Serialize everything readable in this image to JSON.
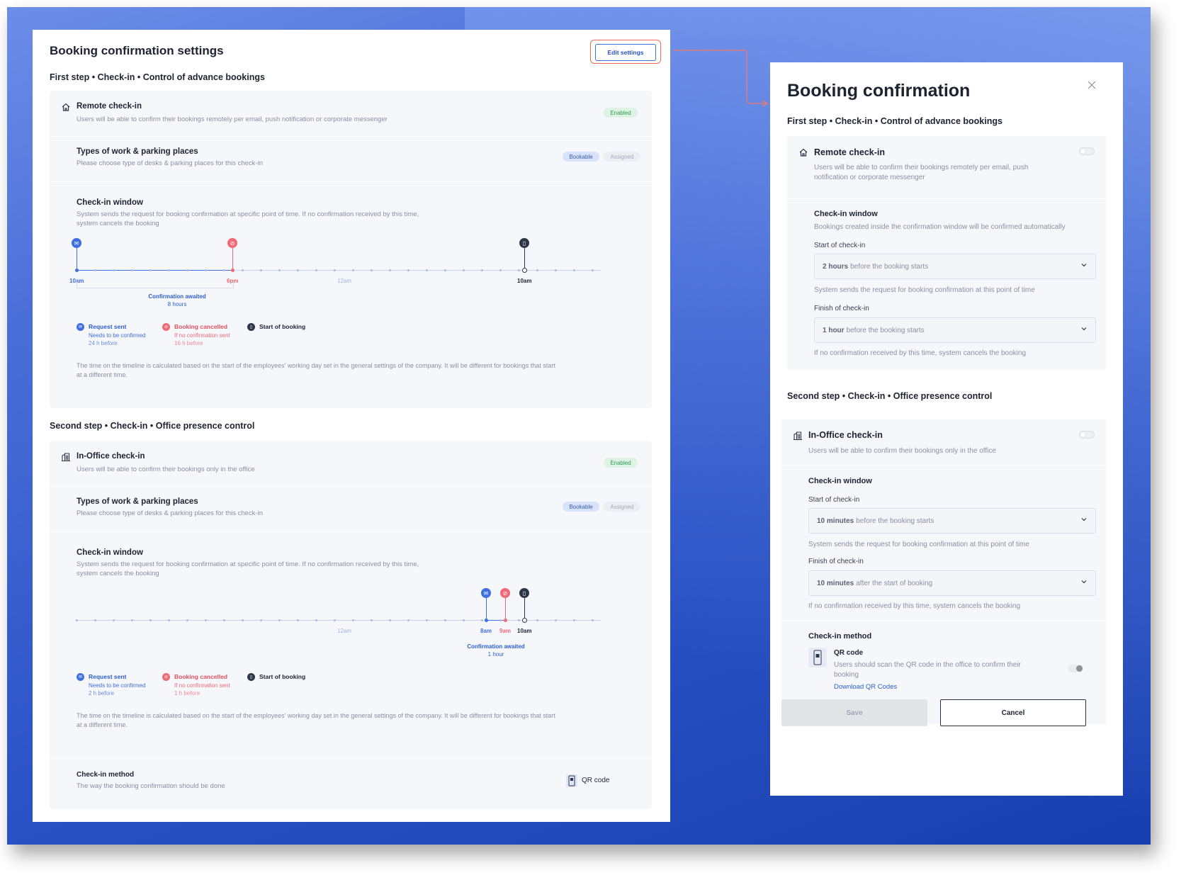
{
  "left": {
    "title": "Booking confirmation settings",
    "edit_button": "Edit settings",
    "step1": {
      "heading": "First step • Check-in • Control of advance bookings",
      "remote": {
        "title": "Remote check-in",
        "desc": "Users will be able to confirm their bookings remotely per email, push notification or corporate messenger",
        "status": "Enabled"
      },
      "types": {
        "title": "Types of work & parking places",
        "desc": "Please choose type of desks & parking places for this check-in",
        "tag_bookable": "Bookable",
        "tag_assigned": "Assigned"
      },
      "window": {
        "title": "Check-in window",
        "desc1": "System sends the request for booking confirmation at specific point of time. If no confirmation received by this time,",
        "desc2": "system cancels the booking",
        "tick_start": "10am",
        "tick_cancel": "6pm",
        "tick_mid": "12am",
        "tick_booking": "10am",
        "awaited_title": "Confirmation awaited",
        "awaited_value": "8 hours",
        "legend": {
          "sent_title": "Request sent",
          "sent_l1": "Needs to be confirmed",
          "sent_l2": "24 h before",
          "cancel_title": "Booking cancelled",
          "cancel_l1": "If no confirmation sent",
          "cancel_l2": "16 h before",
          "start_title": "Start of booking"
        },
        "note1": "The time on the timeline is calculated based on the start of the employees' working day set in the general settings of the company. It will be different for bookings that start",
        "note2": "at a different time."
      }
    },
    "step2": {
      "heading": "Second step • Check-in • Office presence control",
      "office": {
        "title": "In-Office check-in",
        "desc": "Users will be able to confirm their bookings only in the office",
        "status": "Enabled"
      },
      "types": {
        "title": "Types of work & parking places",
        "desc": "Please choose type of desks & parking places for this check-in",
        "tag_bookable": "Bookable",
        "tag_assigned": "Assigned"
      },
      "window": {
        "title": "Check-in window",
        "desc1": "System sends the request for booking confirmation at specific point of time. If no confirmation received by this time,",
        "desc2": "system cancels the booking",
        "tick_mid": "12am",
        "tick_start": "8am",
        "tick_cancel": "9am",
        "tick_booking": "10am",
        "awaited_title": "Confirmation awaited",
        "awaited_value": "1 hour",
        "legend": {
          "sent_title": "Request sent",
          "sent_l1": "Needs to be confirmed",
          "sent_l2": "2 h before",
          "cancel_title": "Booking cancelled",
          "cancel_l1": "If no confirmation sent",
          "cancel_l2": "1 h before",
          "start_title": "Start of booking"
        },
        "note1": "The time on the timeline is calculated based on the start of the employees' working day set in the general settings of the company. It will be different for bookings that start",
        "note2": "at a different time."
      },
      "method": {
        "title": "Check-in method",
        "desc": "The way the booking confirmation should be done",
        "value": "QR code"
      }
    }
  },
  "right": {
    "title": "Booking confirmation",
    "step1": {
      "heading": "First step • Check-in • Control of advance bookings",
      "remote": {
        "title": "Remote check-in",
        "desc1": "Users will be able to confirm their bookings remotely per email, push",
        "desc2": "notification or corporate messenger"
      },
      "window": {
        "title": "Check-in window",
        "desc": "Bookings created inside the confirmation window will be confirmed automatically",
        "start_label": "Start of check-in",
        "start_bold": "2 hours",
        "start_rest": "before the booking starts",
        "start_help": "System sends the request for booking confirmation at this point of time",
        "finish_label": "Finish of check-in",
        "finish_bold": "1 hour",
        "finish_rest": "before the booking starts",
        "finish_help": "If no confirmation received by this time, system cancels the booking"
      }
    },
    "step2": {
      "heading": "Second step • Check-in • Office presence control",
      "office": {
        "title": "In-Office check-in",
        "desc": "Users will be able to confirm their bookings only in the office"
      },
      "window": {
        "title": "Check-in window",
        "start_label": "Start of check-in",
        "start_bold": "10 minutes",
        "start_rest": "before the booking starts",
        "start_help": "System sends the request for booking confirmation at this point of time",
        "finish_label": "Finish of check-in",
        "finish_bold": "10 minutes",
        "finish_rest": "after the start of booking",
        "finish_help": "If no confirmation received by this time, system cancels the booking"
      },
      "method": {
        "title": "Check-in method",
        "qr_title": "QR code",
        "qr_desc1": "Users should scan the QR code in the office to confirm their",
        "qr_desc2": "booking",
        "qr_link": "Download QR Codes"
      }
    },
    "save": "Save",
    "cancel": "Cancel"
  },
  "colors": {
    "accent": "#3f6fe0",
    "danger": "#ef6a75",
    "success": "#2f9b52",
    "highlight": "#ef6a5b"
  }
}
